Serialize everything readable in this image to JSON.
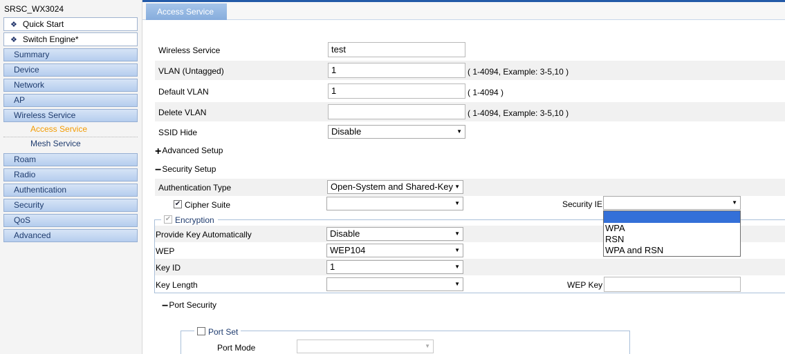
{
  "sidebar": {
    "device_name": "SRSC_WX3024",
    "quick_start": "Quick Start",
    "switch_engine": "Switch Engine*",
    "nav": {
      "summary": "Summary",
      "device": "Device",
      "network": "Network",
      "ap": "AP",
      "wireless_service": "Wireless Service",
      "roam": "Roam",
      "radio": "Radio",
      "authentication": "Authentication",
      "security": "Security",
      "qos": "QoS",
      "advanced": "Advanced"
    },
    "sub": {
      "access_service": "Access Service",
      "mesh_service": "Mesh Service"
    }
  },
  "tab": {
    "label": "Access Service"
  },
  "form": {
    "wireless_service": {
      "label": "Wireless Service",
      "value": "test"
    },
    "vlan_untagged": {
      "label": "VLAN (Untagged)",
      "value": "1",
      "hint": "( 1-4094, Example: 3-5,10 )"
    },
    "default_vlan": {
      "label": "Default VLAN",
      "value": "1",
      "hint": "( 1-4094 )"
    },
    "delete_vlan": {
      "label": "Delete VLAN",
      "value": "",
      "hint": "( 1-4094, Example: 3-5,10 )"
    },
    "ssid_hide": {
      "label": "SSID Hide",
      "value": "Disable"
    },
    "advanced_setup": {
      "label": "Advanced Setup",
      "symbol": "+"
    },
    "security_setup": {
      "label": "Security Setup",
      "symbol": "−"
    },
    "authentication_type": {
      "label": "Authentication Type",
      "value": "Open-System and Shared-Key"
    },
    "cipher_suite": {
      "label": "Cipher Suite",
      "checked": "✔",
      "value": ""
    },
    "security_ie": {
      "label": "Security IE",
      "value": "",
      "options": [
        "",
        "WPA",
        "RSN",
        "WPA and RSN"
      ]
    },
    "encryption": {
      "label": "Encryption",
      "checked": "✔"
    },
    "provide_key_automatically": {
      "label": "Provide Key Automatically",
      "value": "Disable"
    },
    "wep": {
      "label": "WEP",
      "value": "WEP104"
    },
    "key_id": {
      "label": "Key ID",
      "value": "1"
    },
    "key_length": {
      "label": "Key Length",
      "value": ""
    },
    "wep_key": {
      "label": "WEP Key",
      "value": ""
    },
    "port_security": {
      "label": "Port Security",
      "symbol": "−"
    },
    "port_set": {
      "label": "Port Set"
    },
    "port_mode": {
      "label": "Port Mode",
      "value": ""
    }
  },
  "icons": {
    "diamond": "❖",
    "dropdown_arrow": "▼"
  }
}
